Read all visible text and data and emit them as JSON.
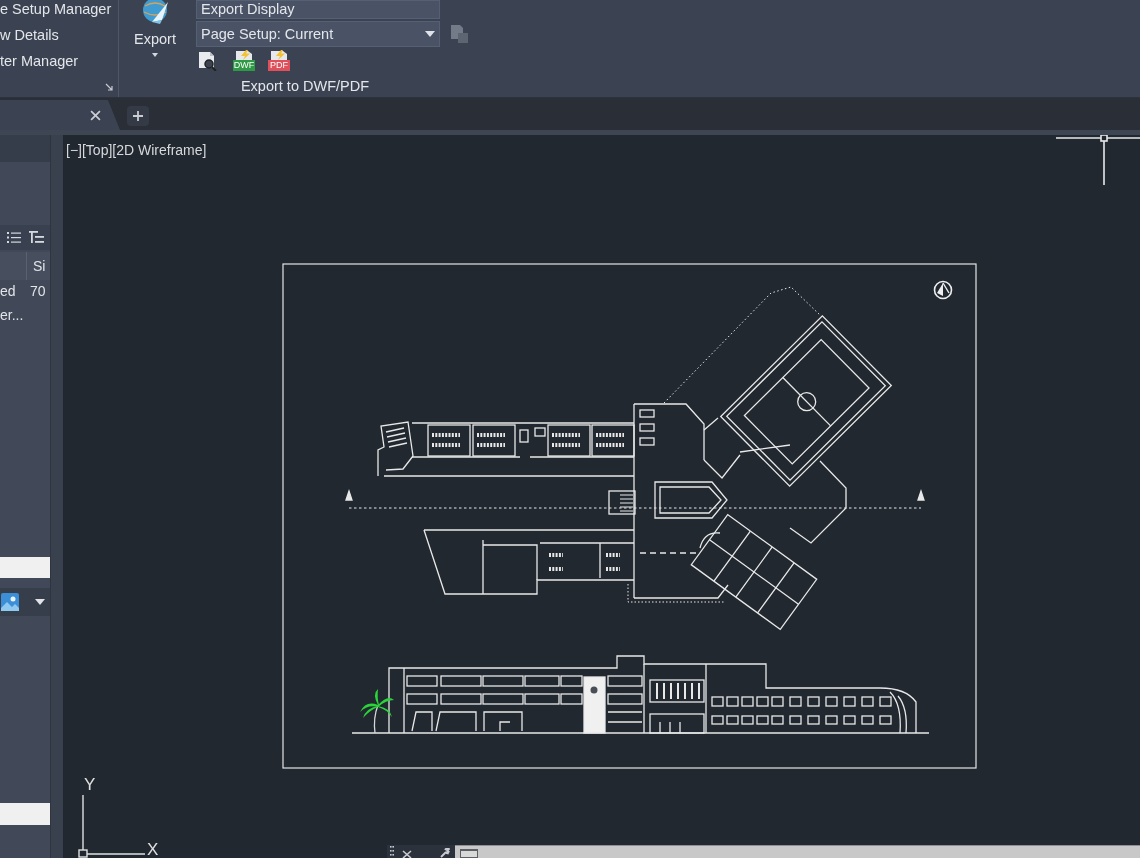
{
  "ribbon": {
    "menu_items": [
      "e Setup Manager",
      "w Details",
      "ter Manager"
    ],
    "export_button": {
      "label": "Export"
    },
    "export_display": {
      "value": "Export Display"
    },
    "page_setup": {
      "value": "Page Setup: Current"
    },
    "page_setup_button": {
      "disabled": true
    },
    "tools": [
      {
        "kind": "preview"
      },
      {
        "kind": "dwf",
        "badge": "DWF"
      },
      {
        "kind": "pdf",
        "badge": "PDF"
      }
    ],
    "panel_title": "Export to DWF/PDF"
  },
  "file_tabs": [
    {
      "selected": true
    }
  ],
  "palette": {
    "column_header": "Si",
    "rows": [
      {
        "cells": [
          "ed",
          "70"
        ]
      },
      {
        "cells": [
          "er..."
        ]
      }
    ]
  },
  "viewport": {
    "controls": [
      "[−]",
      "[Top]",
      "[2D Wireframe]"
    ],
    "ucs": {
      "x_label": "X",
      "y_label": "Y"
    }
  }
}
